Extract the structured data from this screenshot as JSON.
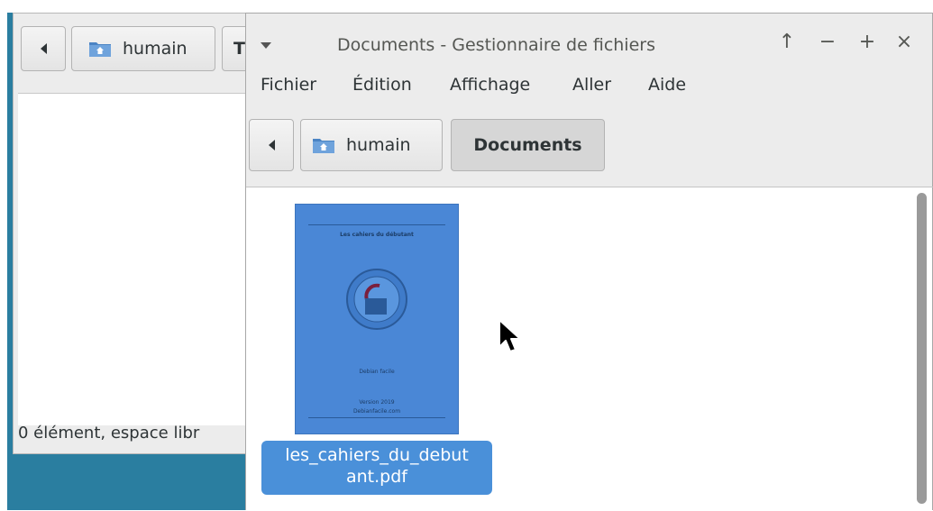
{
  "background_window": {
    "crumbs": [
      "humain",
      "T"
    ],
    "status": "0 élément, espace libr"
  },
  "window": {
    "title": "Documents - Gestionnaire de fichiers",
    "controls": [
      "↑",
      "−",
      "+",
      "×"
    ]
  },
  "menubar": [
    "Fichier",
    "Édition",
    "Affichage",
    "Aller",
    "Aide"
  ],
  "breadcrumb": {
    "items": [
      "humain",
      "Documents"
    ],
    "active_index": 1
  },
  "files": [
    {
      "name_line1": "les_cahiers_du_debut",
      "name_line2": "ant.pdf",
      "selected": true,
      "thumbnail": {
        "title": "Les cahiers du débutant",
        "author": "Debian facile",
        "footer1": "Version 2019",
        "footer2": "Debianfacile.com"
      }
    }
  ],
  "colors": {
    "desktop": "#2a7ea0",
    "selection": "#4a90d9",
    "thumbnail": "#4a87d6"
  }
}
